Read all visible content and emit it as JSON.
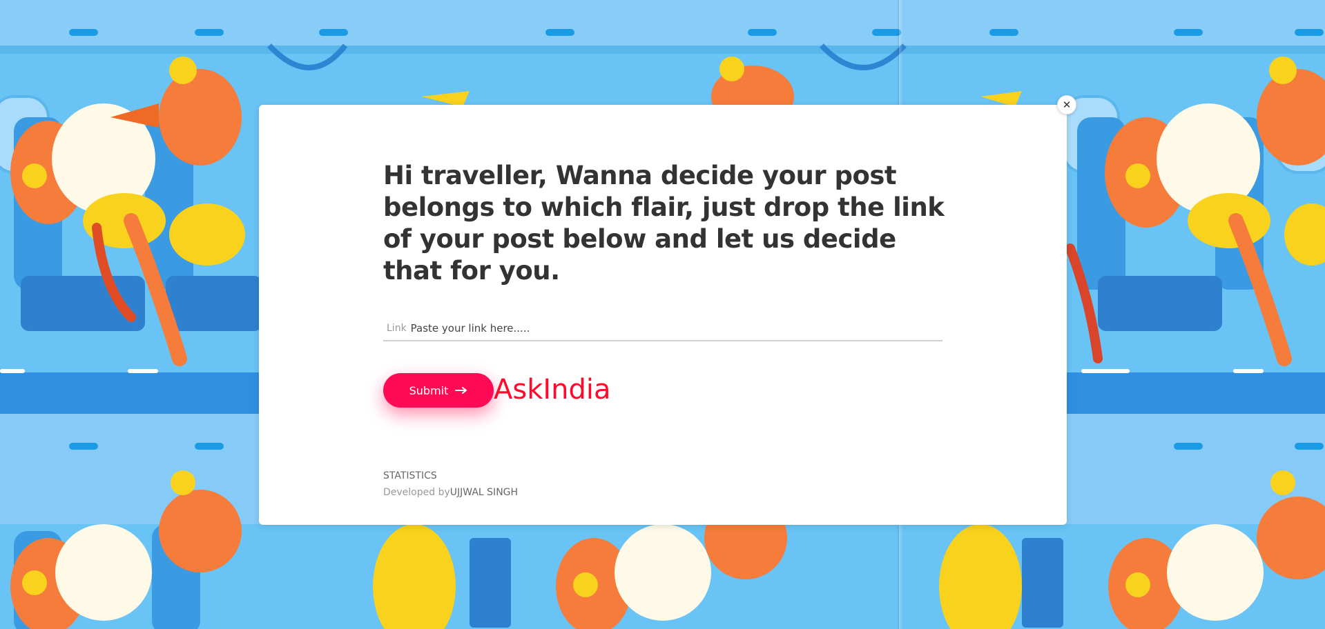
{
  "heading": "Hi traveller, Wanna decide your post belongs to which flair, just drop the link of your post below and let us decide that for you.",
  "form": {
    "link_label": "Link",
    "link_placeholder": "Paste your link here.....",
    "submit_label": "Submit"
  },
  "result": "AskIndia",
  "footer": {
    "stats_label": "STATISTICS",
    "developed_by_prefix": "Developed by",
    "developer_name": "UJJWAL SINGH"
  },
  "icons": {
    "close": "close-icon",
    "submit_arrow": "arrow-right-icon"
  },
  "colors": {
    "accent": "#ff0a54",
    "result_text": "#ff0a2a",
    "background": "#69c3f5",
    "heading": "#333333"
  }
}
